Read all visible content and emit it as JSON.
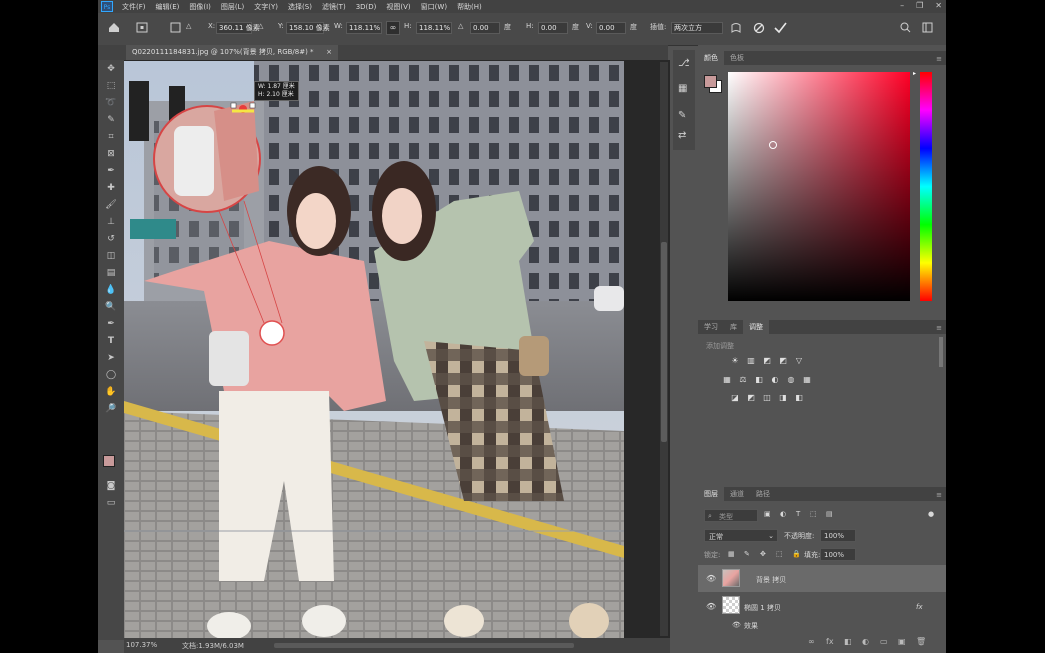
{
  "menu": {
    "logo": "Ps",
    "items": [
      "文件(F)",
      "编辑(E)",
      "图像(I)",
      "图层(L)",
      "文字(Y)",
      "选择(S)",
      "滤镜(T)",
      "3D(D)",
      "视图(V)",
      "窗口(W)",
      "帮助(H)"
    ],
    "window_controls": [
      "–",
      "❐",
      "✕"
    ]
  },
  "options": {
    "x_label": "X:",
    "x_value": "360.11 像素",
    "y_label": "Y:",
    "y_value": "158.10 像素",
    "w_label": "W:",
    "w_value": "118.11%",
    "h_label": "H:",
    "h_value": "118.11%",
    "angle_label": "△",
    "angle_value": "0.00",
    "hskew_label": "H:",
    "hskew_value": "0.00",
    "vskew_label": "V:",
    "vskew_value": "0.00",
    "interp_label": "插值:",
    "interp_value": "两次立方",
    "degree_unit": "度"
  },
  "document": {
    "tab_title": "Q0220111184831.jpg @ 107%(背景 拷贝, RGB/8#) *",
    "tab_close": "×",
    "transform_readout_w": "W: 1.87 厘米",
    "transform_readout_h": "H: 2.10 厘米"
  },
  "status": {
    "zoom": "107.37%",
    "doc_size": "文档:1.93M/6.03M"
  },
  "color_panel": {
    "tabs": [
      "颜色",
      "色板"
    ],
    "foreground": "#c89a9a",
    "background": "#ffffff"
  },
  "adjustments_panel": {
    "tabs": [
      "学习",
      "库",
      "调整"
    ],
    "add_label": "添加调整",
    "row1": [
      "☀",
      "▥",
      "◩",
      "▽"
    ],
    "row2": [
      "▦",
      "⚖",
      "◧",
      "◐",
      "◍",
      "▦"
    ],
    "row3": [
      "◪",
      "◩",
      "◫",
      "◨",
      "◧"
    ]
  },
  "layers_panel": {
    "tabs": [
      "图层",
      "通道",
      "路径"
    ],
    "search_placeholder": "类型",
    "blend_mode": "正常",
    "opacity_label": "不透明度:",
    "opacity_value": "100%",
    "lock_label": "锁定:",
    "fill_label": "填充:",
    "fill_value": "100%",
    "layers": [
      {
        "name": "背景 拷贝",
        "selected": true
      },
      {
        "name": "椭圆 1 拷贝",
        "selected": false,
        "fx": "fx"
      }
    ],
    "effects_label": "效果",
    "bottom_icons": [
      "∞",
      "fx",
      "◧",
      "◐",
      "▭",
      "▣",
      "🗑"
    ]
  }
}
